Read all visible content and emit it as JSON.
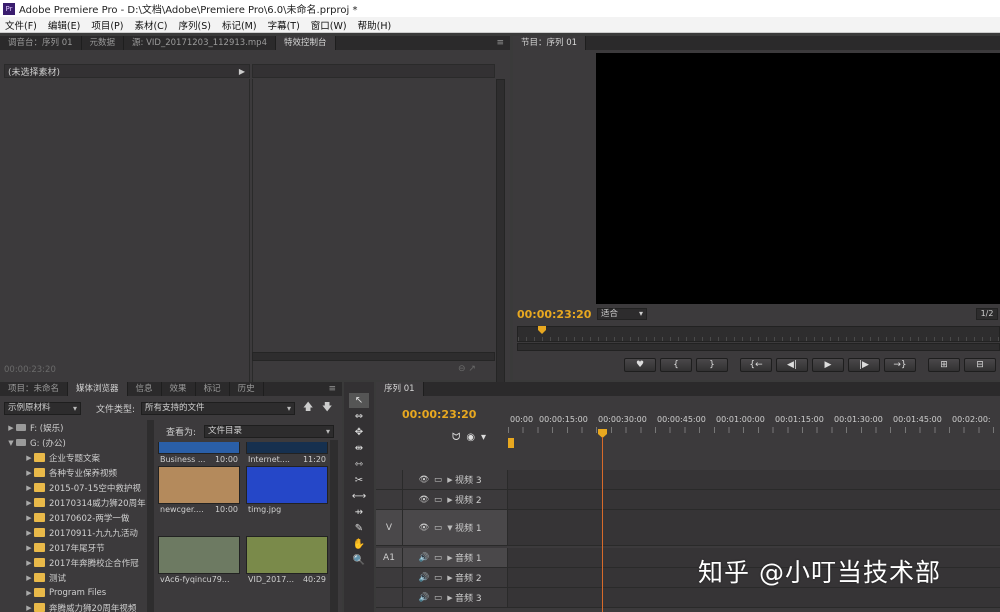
{
  "window": {
    "title": "Adobe Premiere Pro - D:\\文档\\Adobe\\Premiere Pro\\6.0\\未命名.prproj *",
    "logo": "Pr"
  },
  "menu": [
    "文件(F)",
    "编辑(E)",
    "项目(P)",
    "素材(C)",
    "序列(S)",
    "标记(M)",
    "字幕(T)",
    "窗口(W)",
    "帮助(H)"
  ],
  "effect_panel": {
    "tabs": [
      "调音台：序列 01",
      "元数据",
      "源: VID_20171203_112913.mp4",
      "特效控制台"
    ],
    "menu_icon": "≡",
    "no_selection": "(未选择素材)",
    "timecode": "00:00:23:20",
    "footer_icons": "⊖ ↗"
  },
  "program_panel": {
    "tab": "节目：序列 01",
    "timecode": "00:00:23:20",
    "fit": "适合",
    "ratio": "1/2",
    "controls": [
      "♥",
      "{",
      "}",
      "{←",
      "◀|",
      "▶",
      "|▶",
      "→}",
      "⊞",
      "⊟",
      "⊡"
    ]
  },
  "media_panel": {
    "tabs": [
      "项目：未命名",
      "媒体浏览器",
      "信息",
      "效果",
      "标记",
      "历史"
    ],
    "source": "示例原材料",
    "filetype_label": "文件类型:",
    "filetype_value": "所有支持的文件",
    "view_label": "查看为:",
    "view_value": "文件目录",
    "tree": [
      {
        "kind": "drive",
        "label": "F: (娱乐)",
        "expanded": false,
        "indent": 0
      },
      {
        "kind": "drive",
        "label": "G: (办公)",
        "expanded": true,
        "indent": 0
      },
      {
        "kind": "folder",
        "label": "企业专题文案",
        "indent": 1
      },
      {
        "kind": "folder",
        "label": "各种专业保养视频",
        "indent": 1
      },
      {
        "kind": "folder",
        "label": "2015-07-15空中救护视",
        "indent": 1
      },
      {
        "kind": "folder",
        "label": "20170314威力狮20周年",
        "indent": 1
      },
      {
        "kind": "folder",
        "label": "20170602-两学一做",
        "indent": 1
      },
      {
        "kind": "folder",
        "label": "20170911-九九九活动",
        "indent": 1
      },
      {
        "kind": "folder",
        "label": "2017年尾牙节",
        "indent": 1
      },
      {
        "kind": "folder",
        "label": "2017年奔腾校企合作冠",
        "indent": 1
      },
      {
        "kind": "folder",
        "label": "测试",
        "indent": 1
      },
      {
        "kind": "folder",
        "label": "Program Files",
        "indent": 1
      },
      {
        "kind": "folder",
        "label": "奔腾威力狮20周年视频",
        "indent": 1
      }
    ],
    "thumbs": [
      {
        "name": "Business ...",
        "dur": "10:00",
        "color": "#2a5fa8"
      },
      {
        "name": "Internet....",
        "dur": "11:20",
        "color": "#16304f"
      },
      {
        "name": "newcger....",
        "dur": "10:00",
        "color": "#b48a5c"
      },
      {
        "name": "timg.jpg",
        "dur": "",
        "color": "#2547c8"
      },
      {
        "name": "vAc6-fyqincu79...",
        "dur": "",
        "color": "#6d7a62"
      },
      {
        "name": "VID_2017...",
        "dur": "40:29",
        "color": "#7a8a4a"
      }
    ]
  },
  "tools": [
    "↖",
    "⇔",
    "✥",
    "⇹",
    "⇿",
    "✂",
    "⟷",
    "⇸",
    "✎",
    "✋",
    "🔍"
  ],
  "timeline": {
    "tab": "序列 01",
    "timecode": "00:00:23:20",
    "ticks": [
      "00:00",
      "00:00:15:00",
      "00:00:30:00",
      "00:00:45:00",
      "00:01:00:00",
      "00:01:15:00",
      "00:01:30:00",
      "00:01:45:00",
      "00:02:00:"
    ],
    "tracks": [
      {
        "label": "",
        "name": "视频 3",
        "type": "video",
        "target": false
      },
      {
        "label": "",
        "name": "视频 2",
        "type": "video",
        "target": false
      },
      {
        "label": "V",
        "name": "视频 1",
        "type": "video",
        "target": true
      },
      {
        "label": "A1",
        "name": "音频 1",
        "type": "audio",
        "target": true
      },
      {
        "label": "",
        "name": "音频 2",
        "type": "audio",
        "target": false
      },
      {
        "label": "",
        "name": "音频 3",
        "type": "audio",
        "target": false
      }
    ]
  },
  "watermark": "知乎 @小叮当技术部"
}
